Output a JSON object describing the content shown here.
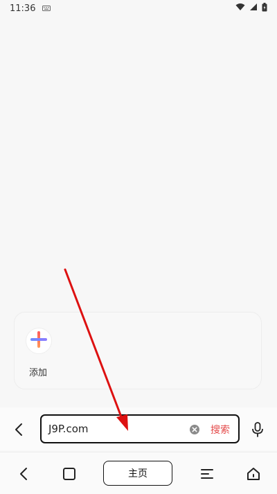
{
  "status_bar": {
    "time": "11:36"
  },
  "shortcuts": {
    "add_label": "添加"
  },
  "search": {
    "url_value": "J9P.com",
    "search_label": "搜索"
  },
  "bottom_nav": {
    "home_label": "主页"
  },
  "colors": {
    "accent_red": "#e44a4a",
    "annotation_red": "#dd1111"
  },
  "icons": [
    "back-icon",
    "clear-icon",
    "mic-icon",
    "tabs-icon",
    "menu-icon",
    "home-icon",
    "wifi-icon",
    "signal-icon",
    "battery-icon"
  ]
}
